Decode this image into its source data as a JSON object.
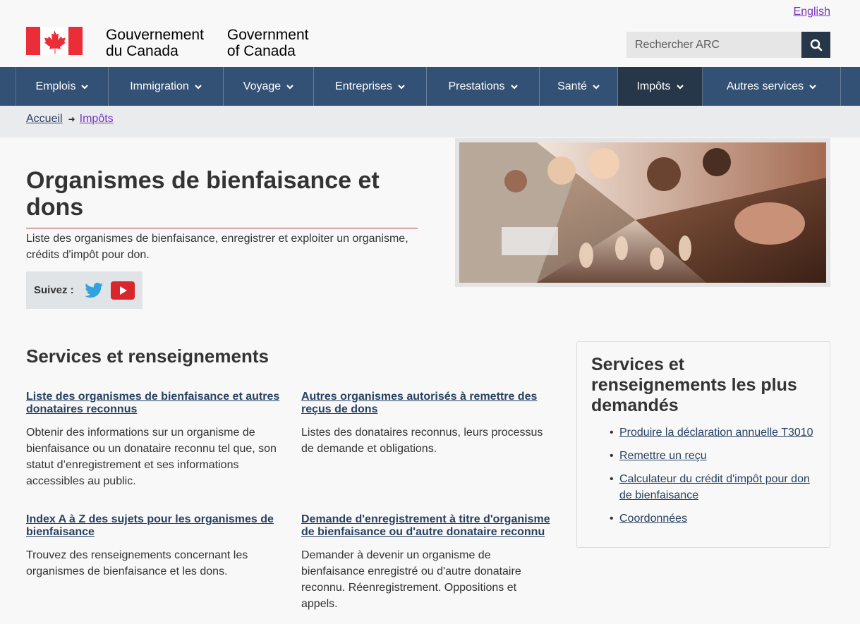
{
  "header": {
    "lang_link": "English",
    "wordmark_fr": [
      "Gouvernement",
      "du Canada"
    ],
    "wordmark_en": [
      "Government",
      "of Canada"
    ],
    "search_placeholder": "Rechercher ARC",
    "colors": {
      "flag_red": "#eb2d37",
      "menu_bg": "#335075",
      "menu_active": "#26374a"
    }
  },
  "menu": {
    "items": [
      {
        "label": "Emplois",
        "width": 131
      },
      {
        "label": "Immigration",
        "width": 163
      },
      {
        "label": "Voyage",
        "width": 128
      },
      {
        "label": "Entreprises",
        "width": 160
      },
      {
        "label": "Prestations",
        "width": 160
      },
      {
        "label": "Santé",
        "width": 111
      },
      {
        "label": "Impôts",
        "width": 120,
        "active": true
      },
      {
        "label": "Autres services",
        "width": 196
      }
    ]
  },
  "breadcrumb": {
    "home": "Accueil",
    "current": "Impôts"
  },
  "page": {
    "title": "Organismes de bienfaisance et dons",
    "intro": "Liste des organismes de bienfaisance, enregistrer et exploiter un organisme, crédits d'impôt pour don.",
    "follow_label": "Suivez :"
  },
  "services": {
    "heading": "Services et renseignements",
    "cards": [
      {
        "title": "Liste des organismes de bienfaisance et autres donataires reconnus",
        "desc": "Obtenir des informations sur un organisme de bienfaisance ou un donataire reconnu tel que, son statut d’enregistrement et ses informations accessibles au public."
      },
      {
        "title": "Autres organismes autorisés à remettre des reçus de dons",
        "desc": "Listes des donataires reconnus, leurs processus de demande et obligations."
      },
      {
        "title": "Index A à Z des sujets pour les organismes de bienfaisance",
        "desc": "Trouvez des renseignements concernant les organismes de bienfaisance et les dons."
      },
      {
        "title": "Demande d'enregistrement à titre d'organisme de bienfaisance ou d'autre donataire reconnu",
        "desc": "Demander à devenir un organisme de bienfaisance enregistré ou d'autre donataire reconnu. Réenregistrement. Oppositions et appels."
      }
    ]
  },
  "most_requested": {
    "heading": "Services et renseignements les plus demandés",
    "links": [
      "Produire la déclaration annuelle T3010",
      "Remettre un reçu",
      "Calculateur du crédit d'impôt pour don de bienfaisance",
      "Coordonnées"
    ]
  }
}
